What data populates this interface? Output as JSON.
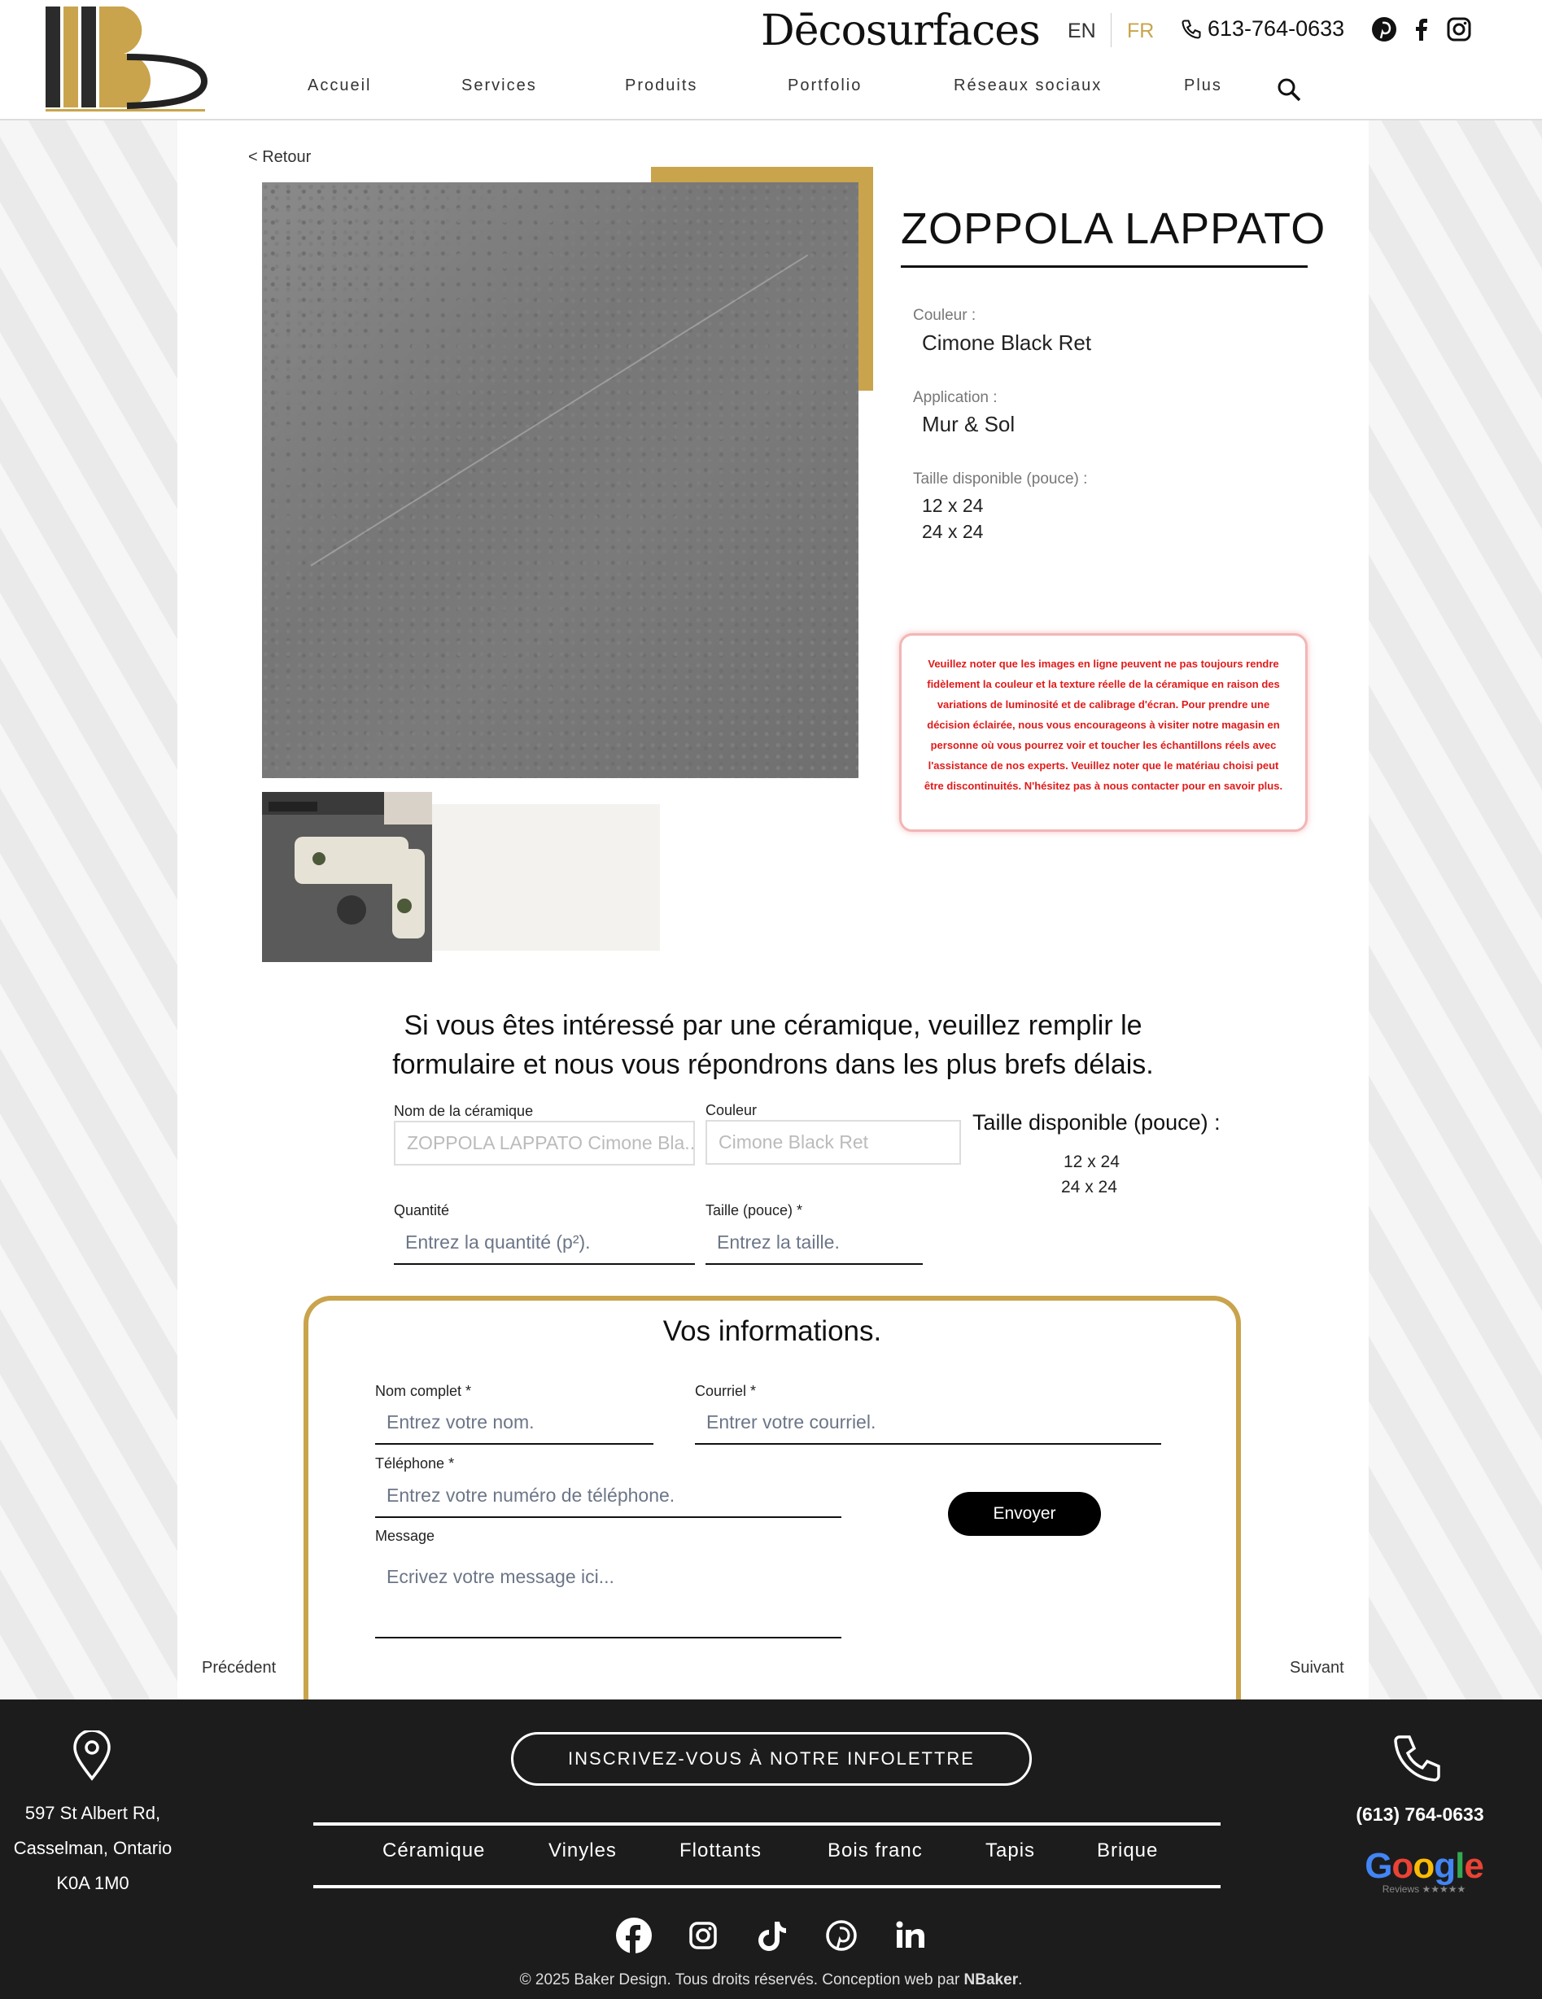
{
  "header": {
    "brand": "Dēcosurfaces",
    "lang_en": "EN",
    "lang_fr": "FR",
    "phone": "613-764-0633",
    "nav": [
      "Accueil",
      "Services",
      "Produits",
      "Portfolio",
      "Réseaux sociaux",
      "Plus"
    ],
    "icons": [
      "pinterest-icon",
      "facebook-icon",
      "instagram-icon",
      "search-icon",
      "phone-icon"
    ]
  },
  "product": {
    "back": "< Retour",
    "title": "ZOPPOLA LAPPATO",
    "color_label": "Couleur :",
    "color_value": "Cimone Black Ret",
    "application_label": "Application :",
    "application_value": "Mur & Sol",
    "sizes_label": "Taille disponible (pouce) :",
    "sizes": [
      "12 x 24",
      "24 x 24"
    ],
    "notice": "Veuillez noter que les images en ligne peuvent ne pas toujours rendre fidèlement la couleur et la texture réelle de la céramique en raison des variations de luminosité et de calibrage d'écran. Pour prendre une décision éclairée, nous vous encourageons à visiter notre magasin en personne où vous pourrez voir et toucher les échantillons réels avec l'assistance de nos experts. Veuillez noter que le matériau choisi peut être discontinuités. N'hésitez pas à nous contacter pour en savoir plus."
  },
  "form": {
    "heading": "Si vous êtes intéressé par une céramique, veuillez remplir le formulaire et nous vous répondrons dans les plus brefs délais.",
    "ceramic_label": "Nom de la céramique",
    "ceramic_value": "ZOPPOLA LAPPATO Cimone Bla...",
    "color_label": "Couleur",
    "color_value": "Cimone Black Ret",
    "sizes_title": "Taille disponible (pouce) :",
    "sizes": [
      "12 x 24",
      "24 x 24"
    ],
    "qty_label": "Quantité",
    "qty_placeholder": "Entrez la quantité (p²).",
    "size_label": "Taille (pouce) *",
    "size_placeholder": "Entrez la taille."
  },
  "info": {
    "title": "Vos informations.",
    "name_label": "Nom complet *",
    "name_placeholder": "Entrez votre nom.",
    "email_label": "Courriel *",
    "email_placeholder": "Entrer votre courriel.",
    "phone_label": "Téléphone *",
    "phone_placeholder": "Entrez votre numéro de téléphone.",
    "message_label": "Message",
    "message_placeholder": "Ecrivez votre message ici...",
    "send": "Envoyer",
    "prev": "Précédent",
    "next": "Suivant"
  },
  "footer": {
    "address": [
      "597 St Albert Rd,",
      "Casselman, Ontario",
      "K0A 1M0"
    ],
    "newsletter": "INSCRIVEZ-VOUS À NOTRE INFOLETTRE",
    "categories": [
      "Céramique",
      "Vinyles",
      "Flottants",
      "Bois franc",
      "Tapis",
      "Brique"
    ],
    "phone": "(613) 764-0633",
    "google": "Google",
    "google_sub": "Reviews ★★★★★",
    "copyright_pre": "© 2025 Baker Design. Tous droits réservés. Conception web par ",
    "copyright_brand": "NBaker",
    "copyright_post": "."
  },
  "colors": {
    "gold": "#c9a44c",
    "dark": "#1c1c1c",
    "notice_red": "#e01b1b"
  }
}
